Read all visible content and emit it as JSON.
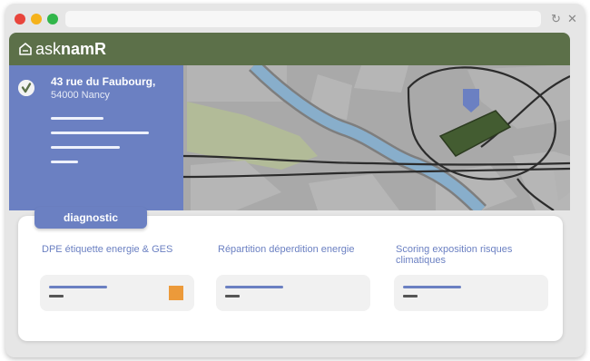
{
  "window": {
    "control_icons": [
      "close-dot",
      "minimize-dot",
      "maximize-dot"
    ],
    "reload_icon": "reload-icon",
    "close_icon": "close-icon"
  },
  "brand": {
    "name_light": "ask",
    "name_bold": "namR",
    "icon": "house-icon",
    "color": "#5c7049"
  },
  "address": {
    "line1": "43 rue du Faubourg,",
    "line2": "54000 Nancy",
    "verified_icon": "check-icon"
  },
  "tab": {
    "label": "diagnostic",
    "color": "#6b80c2"
  },
  "sections": [
    {
      "title": "DPE étiquette energie & GES",
      "badge": "orange-square",
      "badge_color": "#ec9a3a"
    },
    {
      "title": "Répartition déperdition energie"
    },
    {
      "title": "Scoring exposition risques climatiques"
    }
  ],
  "map": {
    "marker_icon": "location-pin-icon",
    "river_color": "#88aecb",
    "building_color": "#435c31"
  }
}
